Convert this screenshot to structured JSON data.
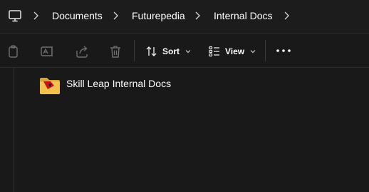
{
  "address_bar": {
    "icon": "this-pc-icon",
    "breadcrumbs": [
      "Documents",
      "Futurepedia",
      "Internal Docs"
    ]
  },
  "command_bar": {
    "icons": [
      "copy-icon",
      "rename-icon",
      "share-icon",
      "delete-icon"
    ],
    "sort_label": "Sort",
    "view_label": "View",
    "more_icon": "more-options-icon"
  },
  "files": [
    {
      "name": "Skill Leap Internal Docs",
      "icon": "folder-icon"
    }
  ],
  "colors": {
    "background": "#191919",
    "text": "#ffffff",
    "icon_disabled": "#6f6f6f",
    "folder": "#f2c14e",
    "folder_accent": "#c4161c"
  }
}
